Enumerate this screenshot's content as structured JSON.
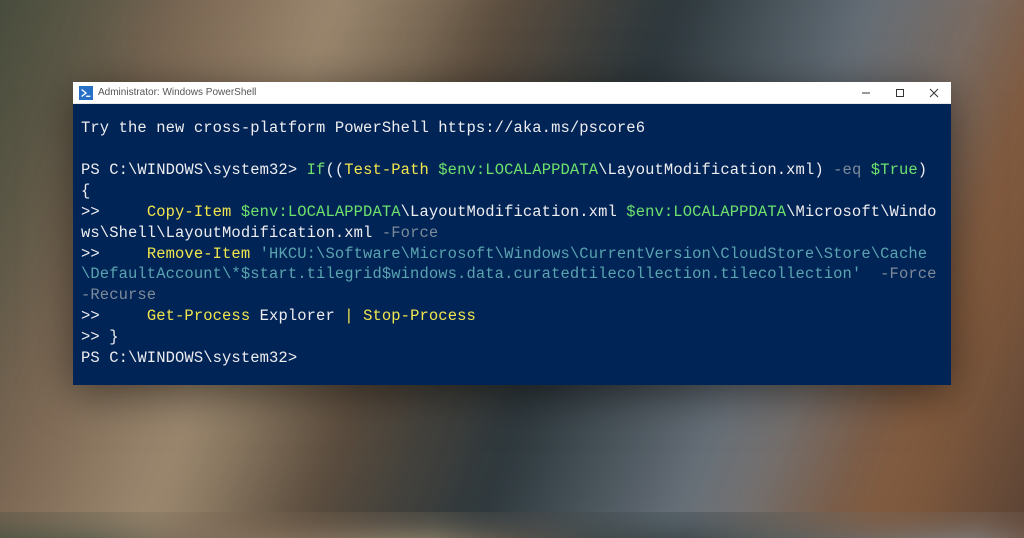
{
  "window": {
    "title": "Administrator: Windows PowerShell"
  },
  "terminal": {
    "banner": "Try the new cross-platform PowerShell https://aka.ms/pscore6",
    "prompt1_path": "PS C:\\WINDOWS\\system32> ",
    "if_kw": "If",
    "paren_open": "((",
    "test_path": "Test-Path ",
    "env1": "$env:LOCALAPPDATA",
    "layout_xml_wrap": "\\LayoutModification.xml) ",
    "eq": "-eq ",
    "true_tok": "$True",
    "paren_close_brace": ") {",
    "cont2": ">>     ",
    "copy_item": "Copy-Item ",
    "env2": "$env:LOCALAPPDATA",
    "layout_xml2": "\\LayoutModification.xml ",
    "env3": "$env:LOCALAPPDATA",
    "ms_path": "\\Microsoft\\Windows\\Shell\\LayoutModification.xml ",
    "force1": "-Force",
    "cont3": ">>     ",
    "remove_item": "Remove-Item ",
    "reg_string": "'HKCU:\\Software\\Microsoft\\Windows\\CurrentVersion\\CloudStore\\Store\\Cache\\DefaultAccount\\*$start.tilegrid$windows.data.curatedtilecollection.tilecollection'",
    "spaces": "  ",
    "force2": "-Force ",
    "recurse": "-Recurse",
    "cont4": ">>     ",
    "get_process": "Get-Process ",
    "explorer": "Explorer ",
    "pipe": "| ",
    "stop_process": "Stop-Process",
    "cont5": ">> ",
    "brace_close": "}",
    "prompt2": "PS C:\\WINDOWS\\system32>"
  }
}
